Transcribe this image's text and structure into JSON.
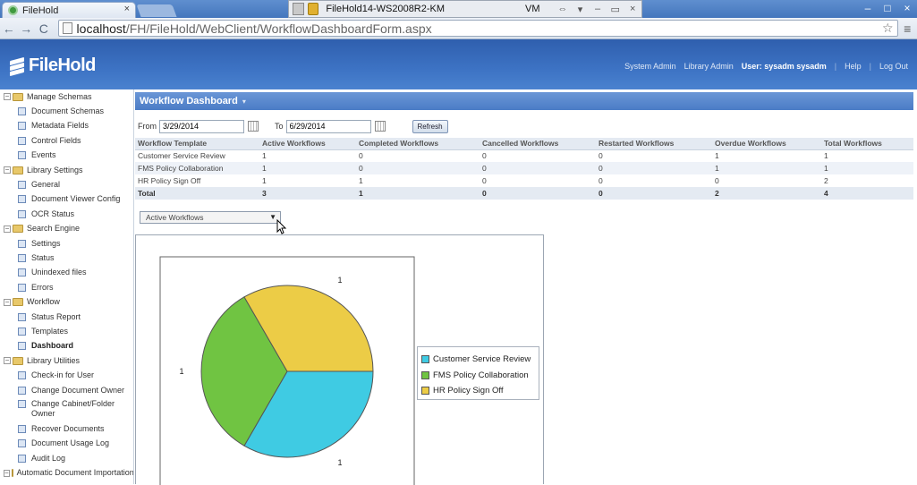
{
  "browser": {
    "tab_title": "FileHold",
    "tab_close": "×",
    "vm_title": "FileHold14-WS2008R2-KM",
    "vm_label": "VM",
    "vm_buttons": [
      "⇔",
      "▾",
      "–",
      "▭",
      "×"
    ],
    "window_controls": [
      "–",
      "□",
      "×"
    ],
    "url_host": "localhost",
    "url_path": "/FH/FileHold/WebClient/WorkflowDashboardForm.aspx",
    "nav": {
      "back": "←",
      "forward": "→",
      "reload": "C"
    },
    "star": "☆",
    "menu": "≡"
  },
  "header": {
    "brand": "FileHold",
    "links": {
      "system_admin": "System Admin",
      "library_admin": "Library Admin",
      "user": "User: sysadm sysadm",
      "sep1": "|",
      "help": "Help",
      "sep2": "|",
      "logout": "Log Out"
    }
  },
  "sidebar": {
    "items": [
      {
        "type": "group",
        "label": "Manage Schemas"
      },
      {
        "type": "child",
        "label": "Document Schemas"
      },
      {
        "type": "child",
        "label": "Metadata Fields"
      },
      {
        "type": "child",
        "label": "Control Fields"
      },
      {
        "type": "child",
        "label": "Events"
      },
      {
        "type": "group",
        "label": "Library Settings"
      },
      {
        "type": "child",
        "label": "General"
      },
      {
        "type": "child",
        "label": "Document Viewer Config"
      },
      {
        "type": "child",
        "label": "OCR Status"
      },
      {
        "type": "group",
        "label": "Search Engine"
      },
      {
        "type": "child",
        "label": "Settings"
      },
      {
        "type": "child",
        "label": "Status"
      },
      {
        "type": "child",
        "label": "Unindexed files"
      },
      {
        "type": "child",
        "label": "Errors"
      },
      {
        "type": "group",
        "label": "Workflow"
      },
      {
        "type": "child",
        "label": "Status Report"
      },
      {
        "type": "child",
        "label": "Templates"
      },
      {
        "type": "child",
        "label": "Dashboard",
        "active": true
      },
      {
        "type": "group",
        "label": "Library Utilities"
      },
      {
        "type": "child",
        "label": "Check-in for User"
      },
      {
        "type": "child",
        "label": "Change Document Owner"
      },
      {
        "type": "child",
        "label": "Change Cabinet/Folder Owner",
        "multi": true
      },
      {
        "type": "child",
        "label": "Recover Documents"
      },
      {
        "type": "child",
        "label": "Document Usage Log"
      },
      {
        "type": "child",
        "label": "Audit Log"
      },
      {
        "type": "group",
        "label": "Automatic Document Importation"
      }
    ]
  },
  "dashboard": {
    "title": "Workflow Dashboard",
    "title_menu": "▾",
    "from_label": "From",
    "from_value": "3/29/2014",
    "to_label": "To",
    "to_value": "6/29/2014",
    "refresh_label": "Refresh",
    "columns": [
      "Workflow Template",
      "Active Workflows",
      "Completed Workflows",
      "Cancelled Workflows",
      "Restarted Workflows",
      "Overdue Workflows",
      "Total Workflows"
    ],
    "rows": [
      [
        "Customer Service Review",
        "1",
        "0",
        "0",
        "0",
        "1",
        "1"
      ],
      [
        "FMS Policy Collaboration",
        "1",
        "0",
        "0",
        "0",
        "1",
        "1"
      ],
      [
        "HR Policy Sign Off",
        "1",
        "1",
        "0",
        "0",
        "0",
        "2"
      ]
    ],
    "total_row": [
      "Total",
      "3",
      "1",
      "0",
      "0",
      "2",
      "4"
    ],
    "chart_select": "Active Workflows",
    "chart_select_arrow": "▼"
  },
  "chart_data": {
    "type": "pie",
    "title": "",
    "categories": [
      "Customer Service Review",
      "FMS Policy Collaboration",
      "HR Policy Sign Off"
    ],
    "values": [
      1,
      1,
      1
    ],
    "data_labels": [
      "1",
      "1",
      "1"
    ],
    "colors": [
      "#3fcbe3",
      "#70c442",
      "#eccc46"
    ],
    "legend_position": "right"
  }
}
